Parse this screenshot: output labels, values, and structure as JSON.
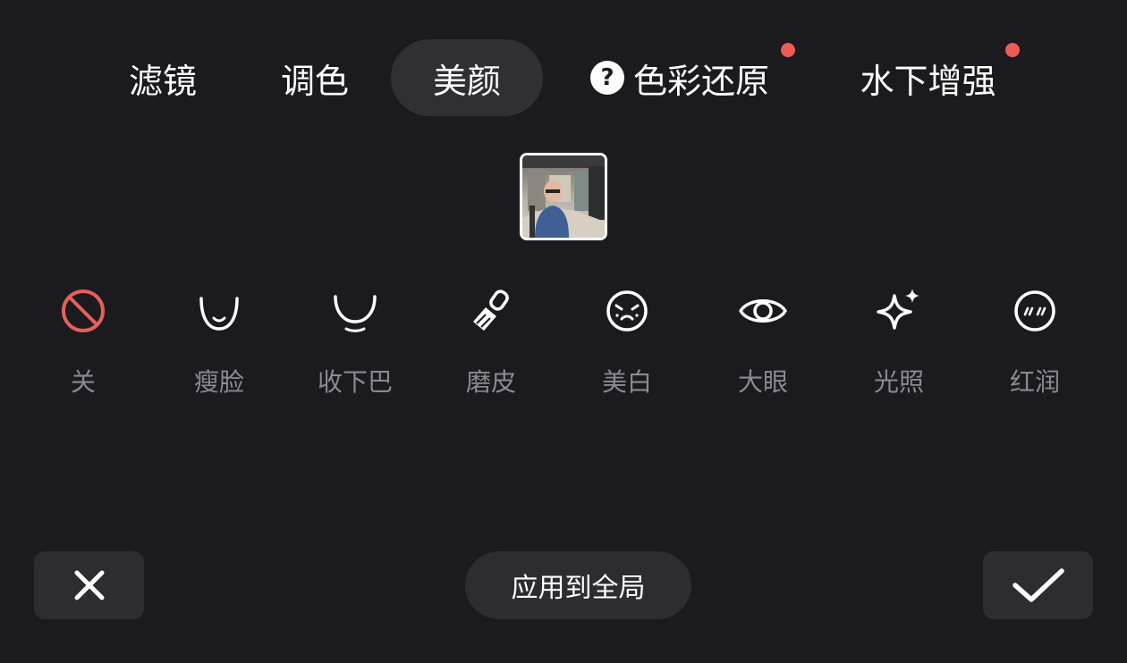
{
  "tabs": [
    {
      "label": "滤镜"
    },
    {
      "label": "调色"
    },
    {
      "label": "美颜",
      "active": true
    },
    {
      "label": "色彩还原",
      "icon": "help-icon",
      "icon_text": "?",
      "badge_dot": true
    },
    {
      "label": "水下增强",
      "badge_dot": true
    }
  ],
  "tools": [
    {
      "label": "关",
      "icon": "disable-icon"
    },
    {
      "label": "瘦脸",
      "icon": "slim-face-icon"
    },
    {
      "label": "收下巴",
      "icon": "chin-icon"
    },
    {
      "label": "磨皮",
      "icon": "brush-icon"
    },
    {
      "label": "美白",
      "icon": "whitening-face-icon"
    },
    {
      "label": "大眼",
      "icon": "eye-icon"
    },
    {
      "label": "光照",
      "icon": "sparkle-icon"
    },
    {
      "label": "红润",
      "icon": "blush-face-icon"
    }
  ],
  "thumbnail": {
    "icon": "person-photo-thumbnail"
  },
  "bottom": {
    "close_icon": "close-icon",
    "apply_label": "应用到全局",
    "confirm_icon": "check-icon"
  },
  "colors": {
    "background": "#1b1b1f",
    "tab_active": "#2f2f34",
    "button_bg": "#2c2c31",
    "badge": "#ec5b56",
    "disable_icon": "#e5605a",
    "tool_label": "#8a8a90"
  }
}
